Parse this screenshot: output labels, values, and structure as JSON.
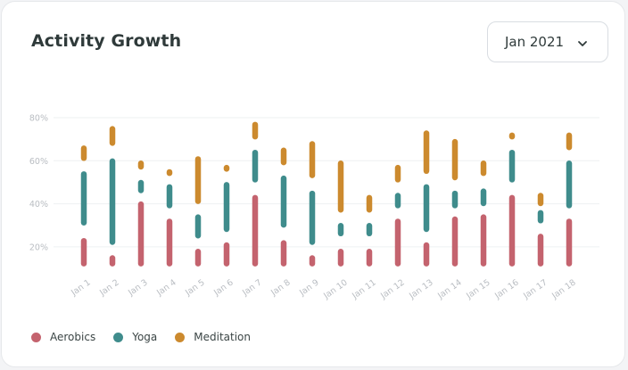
{
  "header": {
    "title": "Activity Growth",
    "month_select": "Jan 2021"
  },
  "icons": {
    "dropdown": "chevron-down-icon"
  },
  "colors": {
    "aerobics": "#c4636e",
    "yoga": "#3f8c8c",
    "meditation": "#cc8a2e",
    "grid": "#eef0f2",
    "tick_text": "#b9bdc2"
  },
  "chart_data": {
    "type": "range-bar",
    "stacked": true,
    "title": "Activity Growth",
    "categories": [
      "Jan 1",
      "Jan 2",
      "Jan 3",
      "Jan 4",
      "Jan 5",
      "Jan 6",
      "Jan 7",
      "Jan 8",
      "Jan 9",
      "Jan 10",
      "Jan 11",
      "Jan 12",
      "Jan 13",
      "Jan 14",
      "Jan 15",
      "Jan 16",
      "Jan 17",
      "Jan 18"
    ],
    "ylim": [
      10,
      80
    ],
    "y_ticks": [
      20,
      40,
      60,
      80
    ],
    "y_tick_labels": [
      "20%",
      "40%",
      "60%",
      "80%"
    ],
    "grid": true,
    "legend_position": "bottom-left",
    "series": [
      {
        "name": "Aerobics",
        "color": "#c4636e",
        "ranges": [
          [
            11,
            24
          ],
          [
            11,
            16
          ],
          [
            11,
            41
          ],
          [
            11,
            33
          ],
          [
            11,
            19
          ],
          [
            11,
            22
          ],
          [
            11,
            44
          ],
          [
            11,
            23
          ],
          [
            11,
            16
          ],
          [
            11,
            19
          ],
          [
            11,
            19
          ],
          [
            11,
            33
          ],
          [
            11,
            22
          ],
          [
            11,
            34
          ],
          [
            11,
            35
          ],
          [
            11,
            44
          ],
          [
            11,
            26
          ],
          [
            11,
            33
          ]
        ]
      },
      {
        "name": "Yoga",
        "color": "#3f8c8c",
        "ranges": [
          [
            30,
            55
          ],
          [
            21,
            61
          ],
          [
            45,
            51
          ],
          [
            38,
            49
          ],
          [
            24,
            35
          ],
          [
            27,
            50
          ],
          [
            50,
            65
          ],
          [
            29,
            53
          ],
          [
            21,
            46
          ],
          [
            25,
            31
          ],
          [
            25,
            31
          ],
          [
            38,
            45
          ],
          [
            27,
            49
          ],
          [
            38,
            46
          ],
          [
            39,
            47
          ],
          [
            50,
            65
          ],
          [
            31,
            37
          ],
          [
            38,
            60
          ]
        ]
      },
      {
        "name": "Meditation",
        "color": "#cc8a2e",
        "ranges": [
          [
            60,
            67
          ],
          [
            67,
            76
          ],
          [
            56,
            60
          ],
          [
            53,
            56
          ],
          [
            40,
            62
          ],
          [
            55,
            58
          ],
          [
            70,
            78
          ],
          [
            58,
            66
          ],
          [
            52,
            69
          ],
          [
            36,
            60
          ],
          [
            36,
            44
          ],
          [
            50,
            58
          ],
          [
            54,
            74
          ],
          [
            51,
            70
          ],
          [
            53,
            60
          ],
          [
            70,
            73
          ],
          [
            39,
            45
          ],
          [
            65,
            73
          ]
        ]
      }
    ]
  }
}
